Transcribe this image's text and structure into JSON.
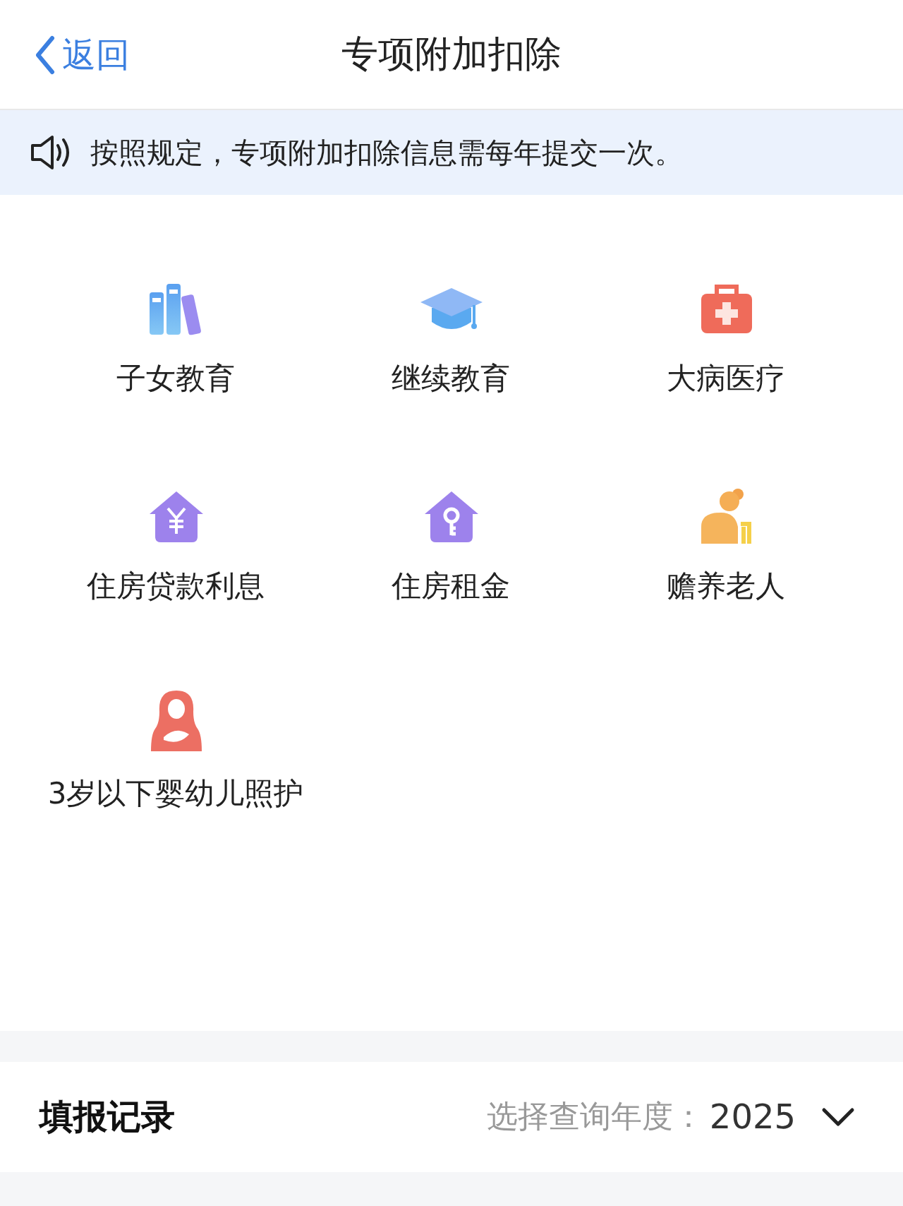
{
  "header": {
    "back": "返回",
    "title": "专项附加扣除"
  },
  "notice": {
    "text": "按照规定，专项附加扣除信息需每年提交一次。"
  },
  "categories": [
    {
      "label": "子女教育",
      "kind": "books"
    },
    {
      "label": "继续教育",
      "kind": "cap"
    },
    {
      "label": "大病医疗",
      "kind": "medkit"
    },
    {
      "label": "住房贷款利息",
      "kind": "house-yen"
    },
    {
      "label": "住房租金",
      "kind": "house-key"
    },
    {
      "label": "赡养老人",
      "kind": "elder"
    },
    {
      "label": "3岁以下婴幼儿照护",
      "kind": "mother"
    }
  ],
  "records": {
    "title": "填报记录",
    "year_label": "选择查询年度：",
    "year": "2025"
  }
}
